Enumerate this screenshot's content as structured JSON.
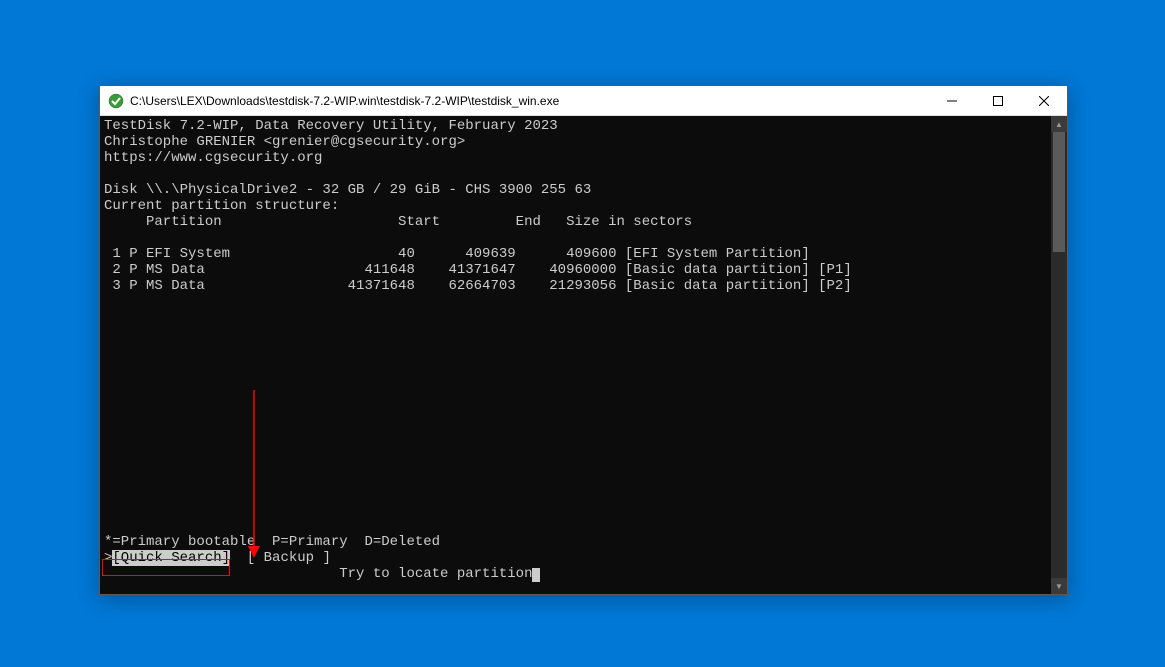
{
  "window": {
    "title": "C:\\Users\\LEX\\Downloads\\testdisk-7.2-WIP.win\\testdisk-7.2-WIP\\testdisk_win.exe"
  },
  "header": {
    "line1": "TestDisk 7.2-WIP, Data Recovery Utility, February 2023",
    "line2": "Christophe GRENIER <grenier@cgsecurity.org>",
    "line3": "https://www.cgsecurity.org"
  },
  "disk_info": "Disk \\\\.\\PhysicalDrive2 - 32 GB / 29 GiB - CHS 3900 255 63",
  "structure_label": "Current partition structure:",
  "columns": {
    "partition": "Partition",
    "start": "Start",
    "end": "End",
    "size": "Size in sectors"
  },
  "partitions": [
    {
      "num": "1",
      "type": "P",
      "name": "EFI System",
      "start": "40",
      "end": "409639",
      "size": "409600",
      "desc": "[EFI System Partition]"
    },
    {
      "num": "2",
      "type": "P",
      "name": "MS Data",
      "start": "411648",
      "end": "41371647",
      "size": "40960000",
      "desc": "[Basic data partition] [P1]"
    },
    {
      "num": "3",
      "type": "P",
      "name": "MS Data",
      "start": "41371648",
      "end": "62664703",
      "size": "21293056",
      "desc": "[Basic data partition] [P2]"
    }
  ],
  "legend": "*=Primary bootable  P=Primary  D=Deleted",
  "menu": {
    "prefix": ">",
    "selected": "[Quick Search]",
    "other": "[ Backup ]"
  },
  "hint": "Try to locate partition",
  "colors": {
    "desktop": "#0178d6",
    "terminal_bg": "#0c0c0c",
    "terminal_fg": "#cccccc",
    "annotation": "#ff0000"
  }
}
